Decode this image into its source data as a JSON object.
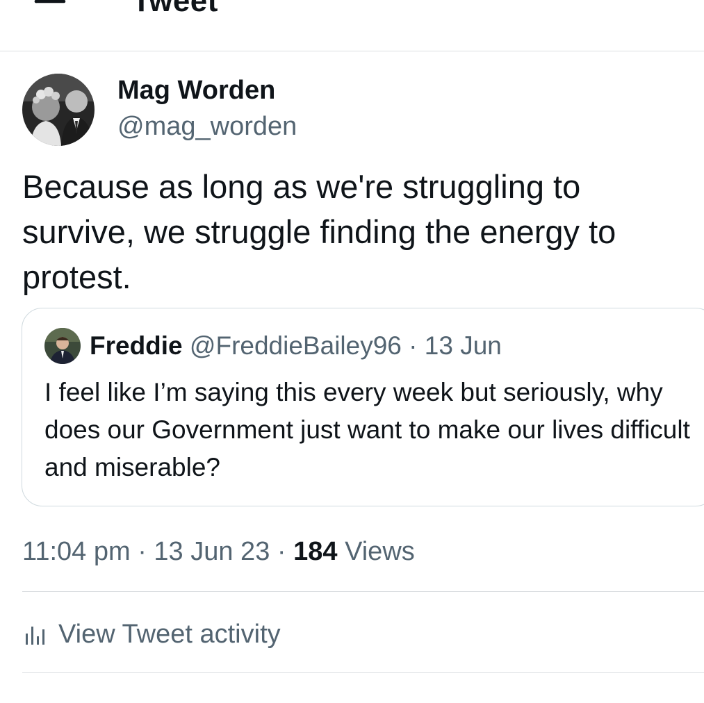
{
  "header": {
    "title": "Tweet",
    "back_icon": "arrow-left-icon"
  },
  "tweet": {
    "author_name": "Mag Worden",
    "author_handle": "@mag_worden",
    "text": "Because as long as we're struggling to survive, we struggle finding the energy to protest.",
    "time": "11:04 pm",
    "date": "13 Jun 23",
    "separator": "·",
    "views_count": "184",
    "views_label": "Views"
  },
  "quoted_tweet": {
    "author_name": "Freddie",
    "author_handle": "@FreddieBailey96",
    "separator": "·",
    "date": "13 Jun",
    "text": "I feel like I’m saying this every week but seriously, why does our Government just want to make our lives difficult and miserable?"
  },
  "activity": {
    "label": "View Tweet activity",
    "icon": "bar-chart-icon"
  },
  "colors": {
    "text_primary": "#0f1419",
    "text_secondary": "#536471",
    "border": "#cfd9de",
    "divider": "#dcdfe2"
  }
}
